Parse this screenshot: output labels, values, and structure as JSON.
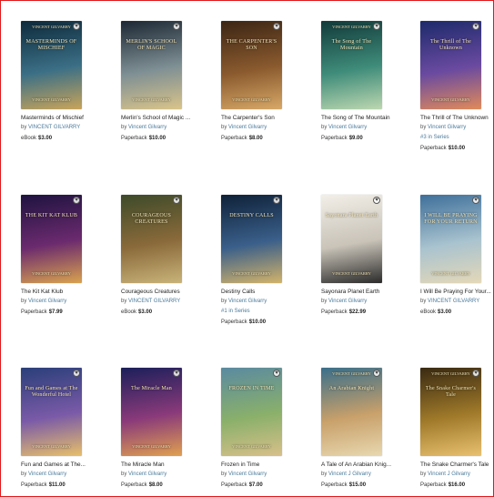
{
  "books": [
    {
      "title": "Masterminds of Mischief",
      "by": "by",
      "author": "VINCENT GILVARRY",
      "format": "eBook",
      "price": "$3.00",
      "series": "",
      "cover_text": "MASTERMINDS OF MISCHIEF",
      "cover_top": "VINCENT GILVARRY",
      "cover_bottom": "VINCENT GILVARRY",
      "colors": [
        "#0e2a3b",
        "#3b6f86",
        "#c8a45a"
      ]
    },
    {
      "title": "Merlin's School of Magic ...",
      "by": "by",
      "author": "Vincent Gilvarry",
      "format": "Paperback",
      "price": "$10.00",
      "series": "",
      "cover_text": "MERLIN'S SCHOOL OF MAGIC",
      "cover_top": "",
      "cover_bottom": "VINCENT GILVARRY",
      "colors": [
        "#1c2733",
        "#7e8f94",
        "#d9c48a"
      ]
    },
    {
      "title": "The Carpenter's Son",
      "by": "by",
      "author": "Vincent Gilvarry",
      "format": "Paperback",
      "price": "$8.00",
      "series": "",
      "cover_text": "THE CARPENTER'S SON",
      "cover_top": "",
      "cover_bottom": "VINCENT GILVARRY",
      "colors": [
        "#3b2514",
        "#8a5a2e",
        "#d7a867"
      ]
    },
    {
      "title": "The Song of The Mountain",
      "by": "by",
      "author": "Vincent Gilvarry",
      "format": "Paperback",
      "price": "$9.00",
      "series": "",
      "cover_text": "The Song of The Mountain",
      "cover_top": "VINCENT GILVARRY",
      "cover_bottom": "",
      "colors": [
        "#123a3a",
        "#3f8c7a",
        "#bcd7b0"
      ]
    },
    {
      "title": "The Thrill of The Unknown",
      "by": "by",
      "author": "Vincent Gilvarry",
      "format": "Paperback",
      "price": "$10.00",
      "series": "#3 in Series",
      "cover_text": "The Thrill of The Unknown",
      "cover_top": "",
      "cover_bottom": "VINCENT GILVARRY",
      "colors": [
        "#1d2a6b",
        "#6a4aa0",
        "#e08a5a"
      ]
    },
    {
      "title": "The Kit Kat Klub",
      "by": "by",
      "author": "Vincent Gilvarry",
      "format": "Paperback",
      "price": "$7.99",
      "series": "",
      "cover_text": "THE KIT KAT KLUB",
      "cover_top": "",
      "cover_bottom": "VINCENT GILVARRY",
      "colors": [
        "#1e1340",
        "#6b2a6e",
        "#d9a24f"
      ]
    },
    {
      "title": "Courageous Creatures",
      "by": "by",
      "author": "VINCENT GILVARRY",
      "format": "eBook",
      "price": "$3.00",
      "series": "",
      "cover_text": "COURAGEOUS CREATURES",
      "cover_top": "",
      "cover_bottom": "",
      "colors": [
        "#3d4a2a",
        "#8a6a3a",
        "#c9b37a"
      ]
    },
    {
      "title": "Destiny Calls",
      "by": "by",
      "author": "Vincent Gilvarry",
      "format": "Paperback",
      "price": "$10.00",
      "series": "#1 in Series",
      "cover_text": "DESTINY CALLS",
      "cover_top": "",
      "cover_bottom": "VINCENT GILVARRY",
      "colors": [
        "#0f2138",
        "#3a5f8a",
        "#d2b36a"
      ]
    },
    {
      "title": "Sayonara Planet Earth",
      "by": "by",
      "author": "Vincent Gilvarry",
      "format": "Paperback",
      "price": "$22.99",
      "series": "",
      "cover_text": "Sayonara Planet Earth",
      "cover_top": "",
      "cover_bottom": "VINCENT GILVARRY",
      "colors": [
        "#f2efe8",
        "#c9c3b8",
        "#2b2b2b"
      ]
    },
    {
      "title": "I Will Be Praying For Your...",
      "by": "by",
      "author": "VINCENT GILVARRY",
      "format": "eBook",
      "price": "$3.00",
      "series": "",
      "cover_text": "I WILL BE PRAYING FOR YOUR RETURN",
      "cover_top": "",
      "cover_bottom": "VINCENT GILVARRY",
      "colors": [
        "#3e6f9a",
        "#a9c3cf",
        "#e4d8b8"
      ]
    },
    {
      "title": "Fun and Games at The...",
      "by": "by",
      "author": "Vincent Gilvarry",
      "format": "Paperback",
      "price": "$11.00",
      "series": "",
      "cover_text": "Fun and Games at The Wonderful Hotel",
      "cover_top": "",
      "cover_bottom": "VINCENT GILVARRY",
      "colors": [
        "#2a3f7a",
        "#7a5aa8",
        "#e8c06a"
      ]
    },
    {
      "title": "The Miracle Man",
      "by": "by",
      "author": "Vincent Gilvarry",
      "format": "Paperback",
      "price": "$8.00",
      "series": "",
      "cover_text": "The Miracle Man",
      "cover_top": "",
      "cover_bottom": "VINCENT GILVARRY",
      "colors": [
        "#1b1f5a",
        "#8a3a7a",
        "#e0a050"
      ]
    },
    {
      "title": "Frozen in Time",
      "by": "by",
      "author": "Vincent Gilvarry",
      "format": "Paperback",
      "price": "$7.00",
      "series": "",
      "cover_text": "FROZEN IN TIME",
      "cover_top": "",
      "cover_bottom": "VINCENT GILVARRY",
      "colors": [
        "#5a8aa0",
        "#8ab06a",
        "#d8c08a"
      ]
    },
    {
      "title": "A Tale of An Arabian Knig...",
      "by": "by",
      "author": "Vincent J Gilvarry",
      "format": "Paperback",
      "price": "$15.00",
      "series": "",
      "cover_text": "An Arabian Knight",
      "cover_top": "VINCENT GILVARRY",
      "cover_bottom": "",
      "colors": [
        "#3a6f8a",
        "#c8a06a",
        "#e8d8b0"
      ]
    },
    {
      "title": "The Snake Charmer's Tale",
      "by": "by",
      "author": "Vincent J Gilvarry",
      "format": "Paperback",
      "price": "$16.00",
      "series": "",
      "cover_text": "The Snake Charmer's Tale",
      "cover_top": "VINCENT GILVARRY",
      "cover_bottom": "",
      "colors": [
        "#3a2a12",
        "#a07a2a",
        "#e8c070"
      ]
    }
  ],
  "favorite_icon_glyph": "♥"
}
